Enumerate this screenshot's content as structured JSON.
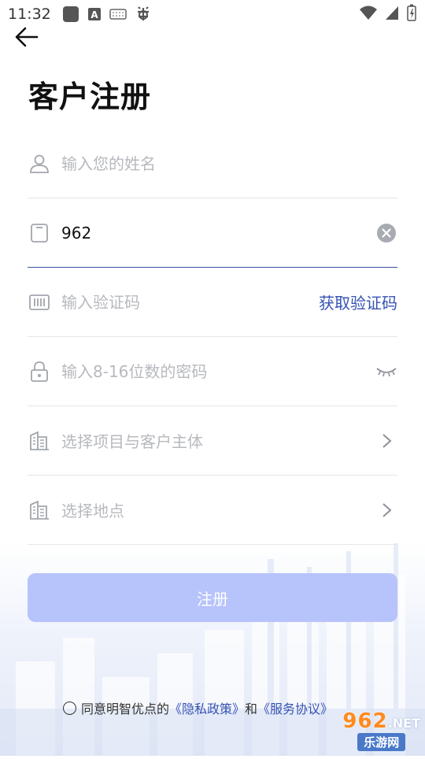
{
  "status_bar": {
    "time": "11:32",
    "icons": [
      "app-square-icon",
      "a-box-icon",
      "keyboard-icon",
      "bug-icon",
      "wifi-icon",
      "signal-icon",
      "battery-icon"
    ]
  },
  "header": {
    "back_icon": "arrow-left-icon",
    "title": "客户注册"
  },
  "form": {
    "name": {
      "icon": "person-icon",
      "placeholder": "输入您的姓名",
      "value": ""
    },
    "phone": {
      "icon": "phone-icon",
      "value": "962",
      "clear_icon": "clear-circle-icon"
    },
    "code": {
      "icon": "barcode-icon",
      "placeholder": "输入验证码",
      "action_label": "获取验证码"
    },
    "password": {
      "icon": "lock-icon",
      "placeholder": "输入8-16位数的密码",
      "toggle_icon": "eye-closed-icon"
    },
    "project": {
      "icon": "building-icon",
      "placeholder": "选择项目与客户主体",
      "chevron": "chevron-right-icon"
    },
    "location": {
      "icon": "building-icon",
      "placeholder": "选择地点",
      "chevron": "chevron-right-icon"
    }
  },
  "register_button": {
    "label": "注册"
  },
  "agreement": {
    "prefix": "同意明智优点的",
    "privacy_link": "《隐私政策》",
    "conjunction": "和",
    "service_link": "《服务协议》"
  },
  "watermark": {
    "num": "962",
    "net": ".NET",
    "cn": "乐游网"
  },
  "colors": {
    "accent": "#3552b3",
    "button_bg": "#b7c3fb",
    "placeholder": "#b7b9be"
  }
}
